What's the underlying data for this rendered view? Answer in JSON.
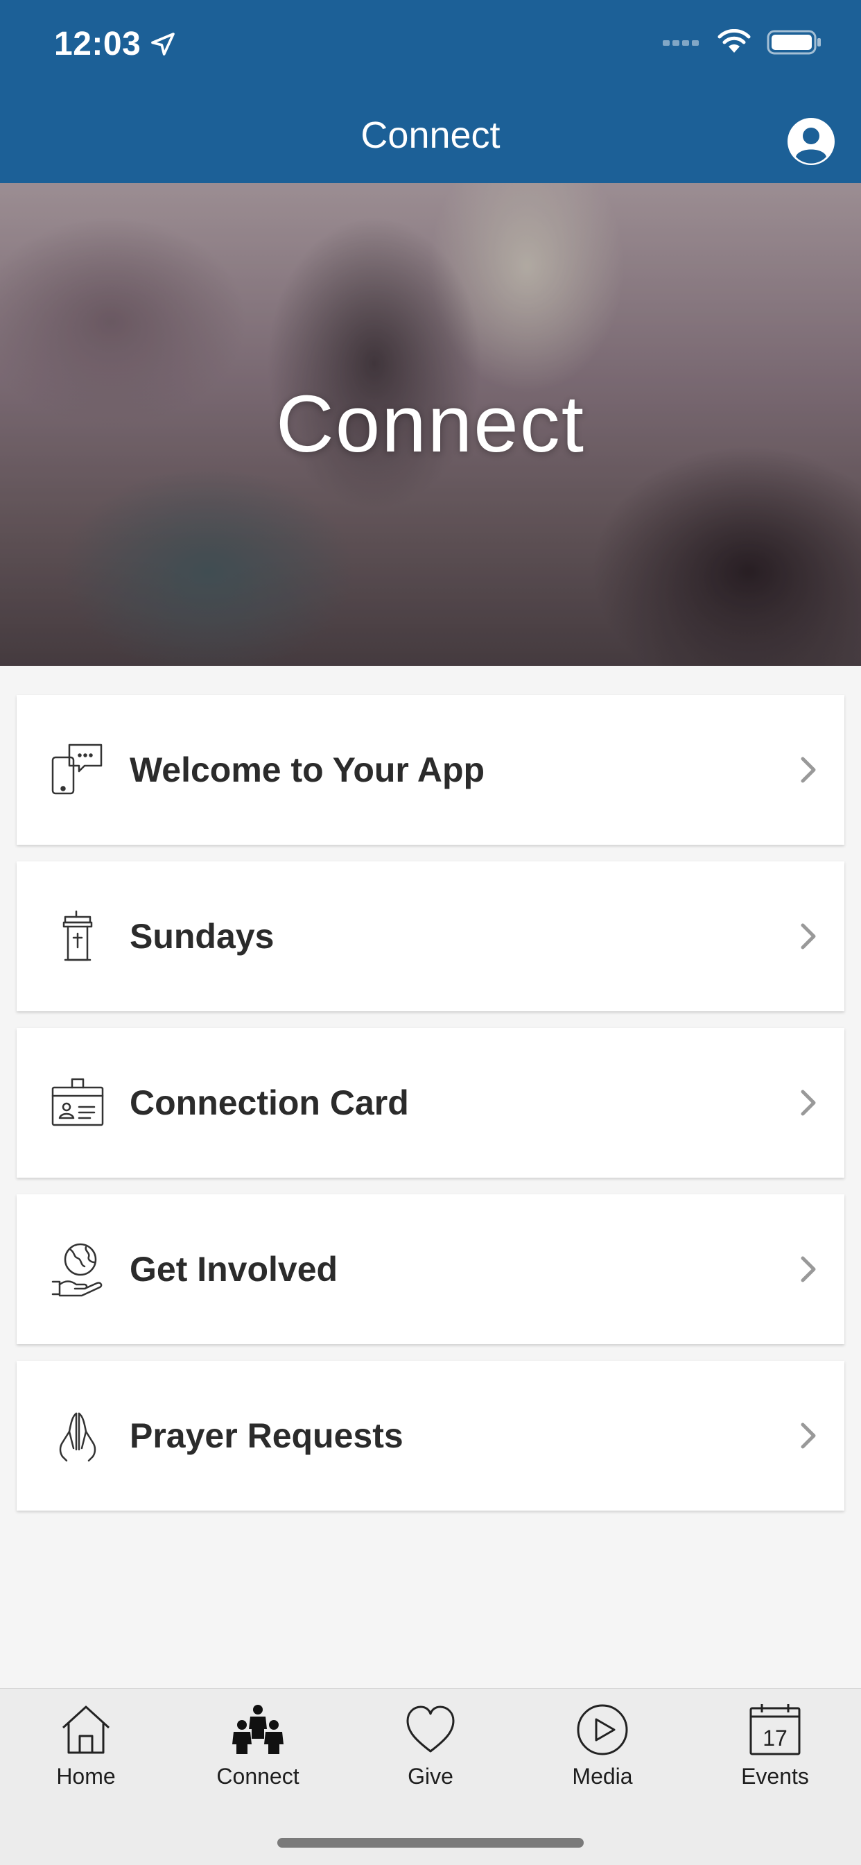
{
  "status": {
    "time": "12:03"
  },
  "header": {
    "title": "Connect"
  },
  "hero": {
    "title": "Connect"
  },
  "menu": [
    {
      "label": "Welcome to Your App",
      "icon": "phone-chat-icon"
    },
    {
      "label": "Sundays",
      "icon": "pulpit-icon"
    },
    {
      "label": "Connection Card",
      "icon": "id-card-icon"
    },
    {
      "label": "Get Involved",
      "icon": "globe-hand-icon"
    },
    {
      "label": "Prayer Requests",
      "icon": "praying-hands-icon"
    }
  ],
  "tabs": [
    {
      "label": "Home",
      "icon": "home-icon"
    },
    {
      "label": "Connect",
      "icon": "people-icon",
      "active": true
    },
    {
      "label": "Give",
      "icon": "heart-icon"
    },
    {
      "label": "Media",
      "icon": "play-icon"
    },
    {
      "label": "Events",
      "icon": "calendar-icon",
      "day": "17"
    }
  ],
  "colors": {
    "header": "#1c6097",
    "tabbar": "#ececec",
    "text": "#2b2b2b"
  }
}
